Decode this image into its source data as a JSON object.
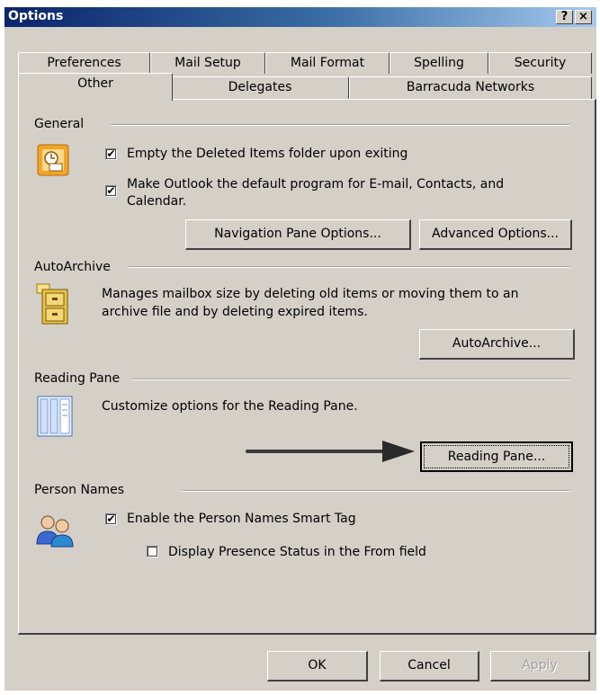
{
  "title": "Options",
  "title_buttons": {
    "help": "?",
    "close": "×"
  },
  "tabs_row1": [
    "Preferences",
    "Mail Setup",
    "Mail Format",
    "Spelling",
    "Security"
  ],
  "tabs_row2": [
    "Other",
    "Delegates",
    "Barracuda Networks"
  ],
  "general": {
    "heading": "General",
    "empty_deleted": "Empty the Deleted Items folder upon exiting",
    "empty_deleted_checked": true,
    "default_program_line1": "Make Outlook the default program for E-mail, Contacts, and",
    "default_program_line2": "Calendar.",
    "default_program_checked": true,
    "nav_pane_button": "Navigation Pane Options...",
    "advanced_button": "Advanced Options..."
  },
  "autoarchive": {
    "heading": "AutoArchive",
    "desc_line1": "Manages mailbox size by deleting old items or moving them to an",
    "desc_line2": "archive file and by deleting expired items.",
    "button": "AutoArchive..."
  },
  "reading_pane": {
    "heading": "Reading Pane",
    "desc": "Customize options for the Reading Pane.",
    "button": "Reading Pane..."
  },
  "person_names": {
    "heading": "Person Names",
    "smart_tag": "Enable the Person Names Smart Tag",
    "smart_tag_checked": true,
    "presence": "Display Presence Status in the From field",
    "presence_checked": false
  },
  "footer": {
    "ok": "OK",
    "cancel": "Cancel",
    "apply": "Apply"
  },
  "icons": {
    "general": "outlook-options-icon",
    "autoarchive": "archive-cabinet-icon",
    "reading_pane": "reading-pane-icon",
    "person_names": "people-icon",
    "arrow": "arrow-right-icon"
  },
  "colors": {
    "titlebar": "#0a246a",
    "dialog": "#d4d0c8"
  }
}
